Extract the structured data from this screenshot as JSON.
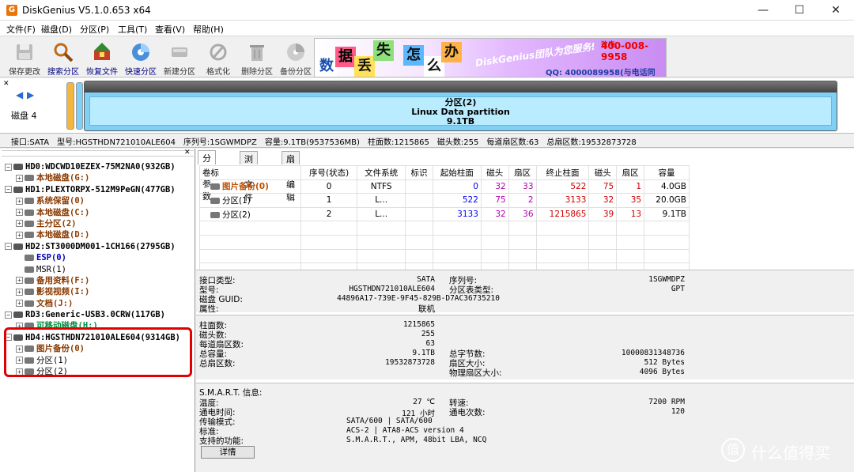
{
  "app": {
    "title": "DiskGenius V5.1.0.653 x64",
    "icon_letter": "G"
  },
  "window_controls": {
    "minimize": "—",
    "maximize": "☐",
    "close": "✕"
  },
  "menu": [
    "文件(F)",
    "磁盘(D)",
    "分区(P)",
    "工具(T)",
    "查看(V)",
    "帮助(H)"
  ],
  "toolbar": [
    {
      "label": "保存更改",
      "icon": "save-icon",
      "enabled": false
    },
    {
      "label": "搜索分区",
      "icon": "search-icon",
      "enabled": true
    },
    {
      "label": "恢复文件",
      "icon": "recover-icon",
      "enabled": true
    },
    {
      "label": "快速分区",
      "icon": "quick-partition-icon",
      "enabled": true
    },
    {
      "label": "新建分区",
      "icon": "new-partition-icon",
      "enabled": false
    },
    {
      "label": "格式化",
      "icon": "format-icon",
      "enabled": false
    },
    {
      "label": "删除分区",
      "icon": "delete-icon",
      "enabled": false
    },
    {
      "label": "备份分区",
      "icon": "backup-icon",
      "enabled": false
    }
  ],
  "banner": {
    "chars": [
      "数",
      "据",
      "丢",
      "失",
      "怎",
      "么",
      "办"
    ],
    "slogan": "DiskGenius团队为您服务!",
    "phone": "400-008-9958",
    "phone_label": "致电:",
    "qq": "QQ: 4000089958(与电话同号)"
  },
  "diskbar": {
    "disk_label": "磁盘 4",
    "partition_name": "分区(2)",
    "partition_fs": "Linux Data partition",
    "partition_size": "9.1TB"
  },
  "infoline": {
    "iface": "接口:SATA",
    "model": "型号:HGSTHDN721010ALE604",
    "serial": "序列号:1SGWMDPZ",
    "capacity": "容量:9.1TB(9537536MB)",
    "cylinders": "柱面数:1215865",
    "heads": "磁头数:255",
    "sectors_per_track": "每道扇区数:63",
    "total_sectors": "总扇区数:19532873728"
  },
  "tree": [
    {
      "level": 0,
      "text": "HD0:WDCWD10EZEX-75M2NA0(932GB)",
      "kind": "hd",
      "exp": "−"
    },
    {
      "level": 1,
      "text": "本地磁盘(G:)",
      "kind": "pt",
      "exp": "+"
    },
    {
      "level": 0,
      "text": "HD1:PLEXTORPX-512M9PeGN(477GB)",
      "kind": "hd",
      "exp": "−"
    },
    {
      "level": 1,
      "text": "系统保留(0)",
      "kind": "pt",
      "exp": "+"
    },
    {
      "level": 1,
      "text": "本地磁盘(C:)",
      "kind": "pt",
      "exp": "+"
    },
    {
      "level": 1,
      "text": "主分区(2)",
      "kind": "pt",
      "exp": "+"
    },
    {
      "level": 1,
      "text": "本地磁盘(D:)",
      "kind": "pt",
      "exp": "+"
    },
    {
      "level": 0,
      "text": "HD2:ST3000DM001-1CH166(2795GB)",
      "kind": "hd",
      "exp": "−"
    },
    {
      "level": 1,
      "text": "ESP(0)",
      "kind": "blue",
      "exp": ""
    },
    {
      "level": 1,
      "text": "MSR(1)",
      "kind": "plain",
      "exp": ""
    },
    {
      "level": 1,
      "text": "备用资料(F:)",
      "kind": "pt",
      "exp": "+"
    },
    {
      "level": 1,
      "text": "影视视频(I:)",
      "kind": "pt",
      "exp": "+"
    },
    {
      "level": 1,
      "text": "文档(J:)",
      "kind": "pt",
      "exp": "+"
    },
    {
      "level": 0,
      "text": "RD3:Generic-USB3.0CRW(117GB)",
      "kind": "hd",
      "exp": "−"
    },
    {
      "level": 1,
      "text": "可移动磁盘(H:)",
      "kind": "green",
      "exp": "+"
    },
    {
      "level": 0,
      "text": "HD4:HGSTHDN721010ALE604(9314GB)",
      "kind": "hd",
      "exp": "−"
    },
    {
      "level": 1,
      "text": "图片备份(0)",
      "kind": "pt",
      "exp": "+"
    },
    {
      "level": 1,
      "text": "分区(1)",
      "kind": "plain",
      "exp": "+"
    },
    {
      "level": 1,
      "text": "分区(2)",
      "kind": "plain",
      "exp": "+"
    }
  ],
  "tabs": [
    "分区参数",
    "浏览文件",
    "扇区编辑"
  ],
  "table": {
    "headers": [
      "卷标",
      "序号(状态)",
      "文件系统",
      "标识",
      "起始柱面",
      "磁头",
      "扇区",
      "终止柱面",
      "磁头",
      "扇区",
      "容量"
    ],
    "rows": [
      [
        "图片备份(0)",
        "0",
        "NTFS",
        "",
        "0",
        "32",
        "33",
        "522",
        "75",
        "1",
        "4.0GB"
      ],
      [
        "分区(1)",
        "1",
        "L...",
        "",
        "522",
        "75",
        "2",
        "3133",
        "32",
        "35",
        "20.0GB"
      ],
      [
        "分区(2)",
        "2",
        "L...",
        "",
        "3133",
        "32",
        "36",
        "1215865",
        "39",
        "13",
        "9.1TB"
      ]
    ]
  },
  "details": {
    "iface_label": "接口类型:",
    "iface_val": "SATA",
    "serial_label": "序列号:",
    "serial_val": "1SGWMDPZ",
    "model_label": "型号:",
    "model_val": "HGSTHDN721010ALE604",
    "pt_label": "分区表类型:",
    "pt_val": "GPT",
    "guid_label": "磁盘 GUID:",
    "guid_val": "44896A17-739E-9F45-829B-D7AC36735210",
    "attr_label": "属性:",
    "attr_val": "联机",
    "cyl_label": "柱面数:",
    "cyl_val": "1215865",
    "heads_label": "磁头数:",
    "heads_val": "255",
    "spt_label": "每道扇区数:",
    "spt_val": "63",
    "cap_label": "总容量:",
    "cap_val": "9.1TB",
    "bytes_label": "总字节数:",
    "bytes_val": "10000831348736",
    "ts_label": "总扇区数:",
    "ts_val": "19532873728",
    "ss_label": "扇区大小:",
    "ss_val": "512 Bytes",
    "pss_label": "物理扇区大小:",
    "pss_val": "4096 Bytes",
    "smart_label": "S.M.A.R.T. 信息:",
    "temp_label": "温度:",
    "temp_val": "27 ℃",
    "rpm_label": "转速:",
    "rpm_val": "7200 RPM",
    "poh_label": "通电时间:",
    "poh_val": "121 小时",
    "pcc_label": "通电次数:",
    "pcc_val": "120",
    "mode_label": "传输模式:",
    "mode_val": "SATA/600 | SATA/600",
    "std_label": "标准:",
    "std_val": "ACS-2 | ATA8-ACS version 4",
    "feat_label": "支持的功能:",
    "feat_val": "S.M.A.R.T., APM, 48bit LBA, NCQ",
    "detail_button": "详情"
  },
  "watermark": {
    "text": "什么值得买",
    "icon": "值"
  }
}
